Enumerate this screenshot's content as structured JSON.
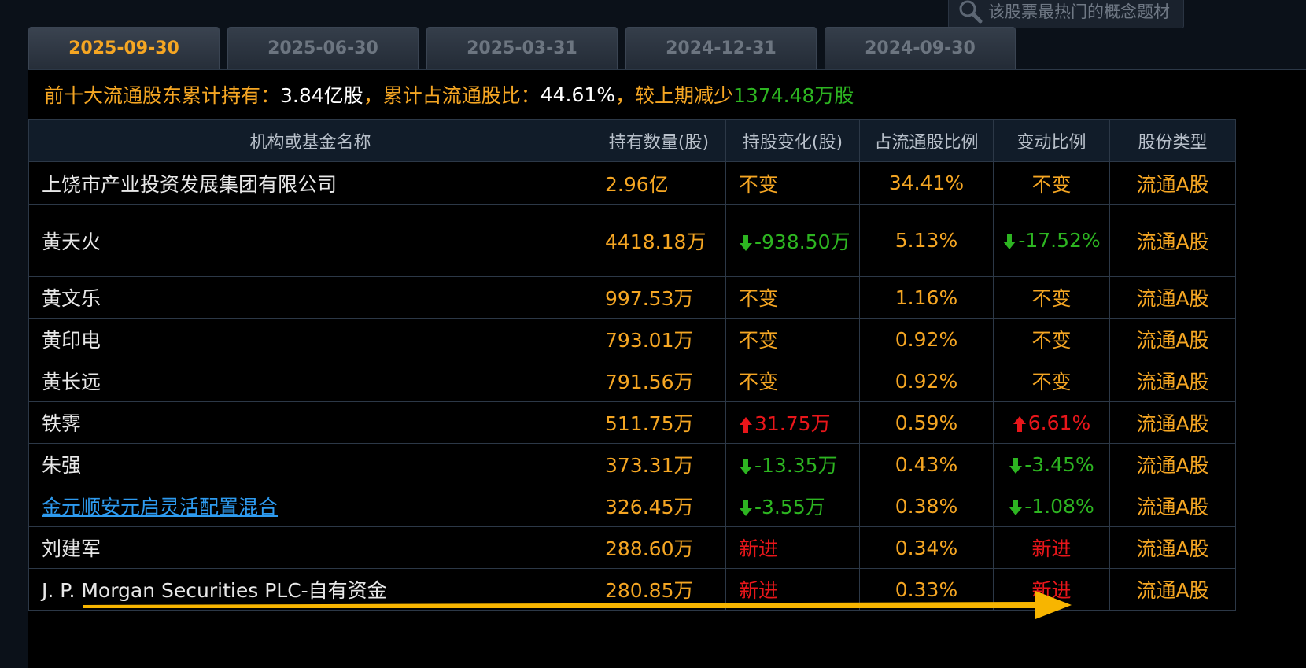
{
  "search": {
    "placeholder": "该股票最热门的概念题材"
  },
  "tabs": [
    {
      "label": "2025-09-30",
      "active": true
    },
    {
      "label": "2025-06-30",
      "active": false
    },
    {
      "label": "2025-03-31",
      "active": false
    },
    {
      "label": "2024-12-31",
      "active": false
    },
    {
      "label": "2024-09-30",
      "active": false
    }
  ],
  "summary": {
    "prefix": "前十大流通股东累计持有：",
    "total_shares": "3.84亿股",
    "ratio_label": "，累计占流通股比：",
    "ratio_value": "44.61%",
    "change_label": " ，较上期减少",
    "change_value": "1374.48万股"
  },
  "table": {
    "headers": [
      "机构或基金名称",
      "持有数量(股)",
      "持股变化(股)",
      "占流通股比例",
      "变动比例",
      "股份类型"
    ],
    "rows": [
      {
        "name": "上饶市产业投资发展集团有限公司",
        "link": false,
        "holding": "2.96亿",
        "change": "不变",
        "change_dir": "none",
        "ratio": "34.41%",
        "change_ratio": "不变",
        "type": "流通A股"
      },
      {
        "name": "黄天火",
        "link": false,
        "holding": "4418.18万",
        "change": "-938.50万",
        "change_dir": "down",
        "ratio": "5.13%",
        "change_ratio": "-17.52%",
        "type": "流通A股"
      },
      {
        "name": "黄文乐",
        "link": false,
        "holding": "997.53万",
        "change": "不变",
        "change_dir": "none",
        "ratio": "1.16%",
        "change_ratio": "不变",
        "type": "流通A股"
      },
      {
        "name": "黄印电",
        "link": false,
        "holding": "793.01万",
        "change": "不变",
        "change_dir": "none",
        "ratio": "0.92%",
        "change_ratio": "不变",
        "type": "流通A股"
      },
      {
        "name": "黄长远",
        "link": false,
        "holding": "791.56万",
        "change": "不变",
        "change_dir": "none",
        "ratio": "0.92%",
        "change_ratio": "不变",
        "type": "流通A股"
      },
      {
        "name": "铁霁",
        "link": false,
        "holding": "511.75万",
        "change": "31.75万",
        "change_dir": "up",
        "ratio": "0.59%",
        "change_ratio": "6.61%",
        "type": "流通A股"
      },
      {
        "name": "朱强",
        "link": false,
        "holding": "373.31万",
        "change": "-13.35万",
        "change_dir": "down",
        "ratio": "0.43%",
        "change_ratio": "-3.45%",
        "type": "流通A股"
      },
      {
        "name": "金元顺安元启灵活配置混合",
        "link": true,
        "holding": "326.45万",
        "change": "-3.55万",
        "change_dir": "down",
        "ratio": "0.38%",
        "change_ratio": "-1.08%",
        "type": "流通A股"
      },
      {
        "name": "刘建军",
        "link": false,
        "holding": "288.60万",
        "change": "新进",
        "change_dir": "new",
        "ratio": "0.34%",
        "change_ratio": "新进",
        "type": "流通A股"
      },
      {
        "name": "J. P. Morgan Securities PLC-自有资金",
        "link": false,
        "holding": "280.85万",
        "change": "新进",
        "change_dir": "new",
        "ratio": "0.33%",
        "change_ratio": "新进",
        "type": "流通A股"
      }
    ]
  },
  "colors": {
    "accent": "#f5a623",
    "up": "#e8161a",
    "down": "#2db521",
    "link": "#2e9bf0",
    "scroll_arrow": "#f7b500"
  }
}
